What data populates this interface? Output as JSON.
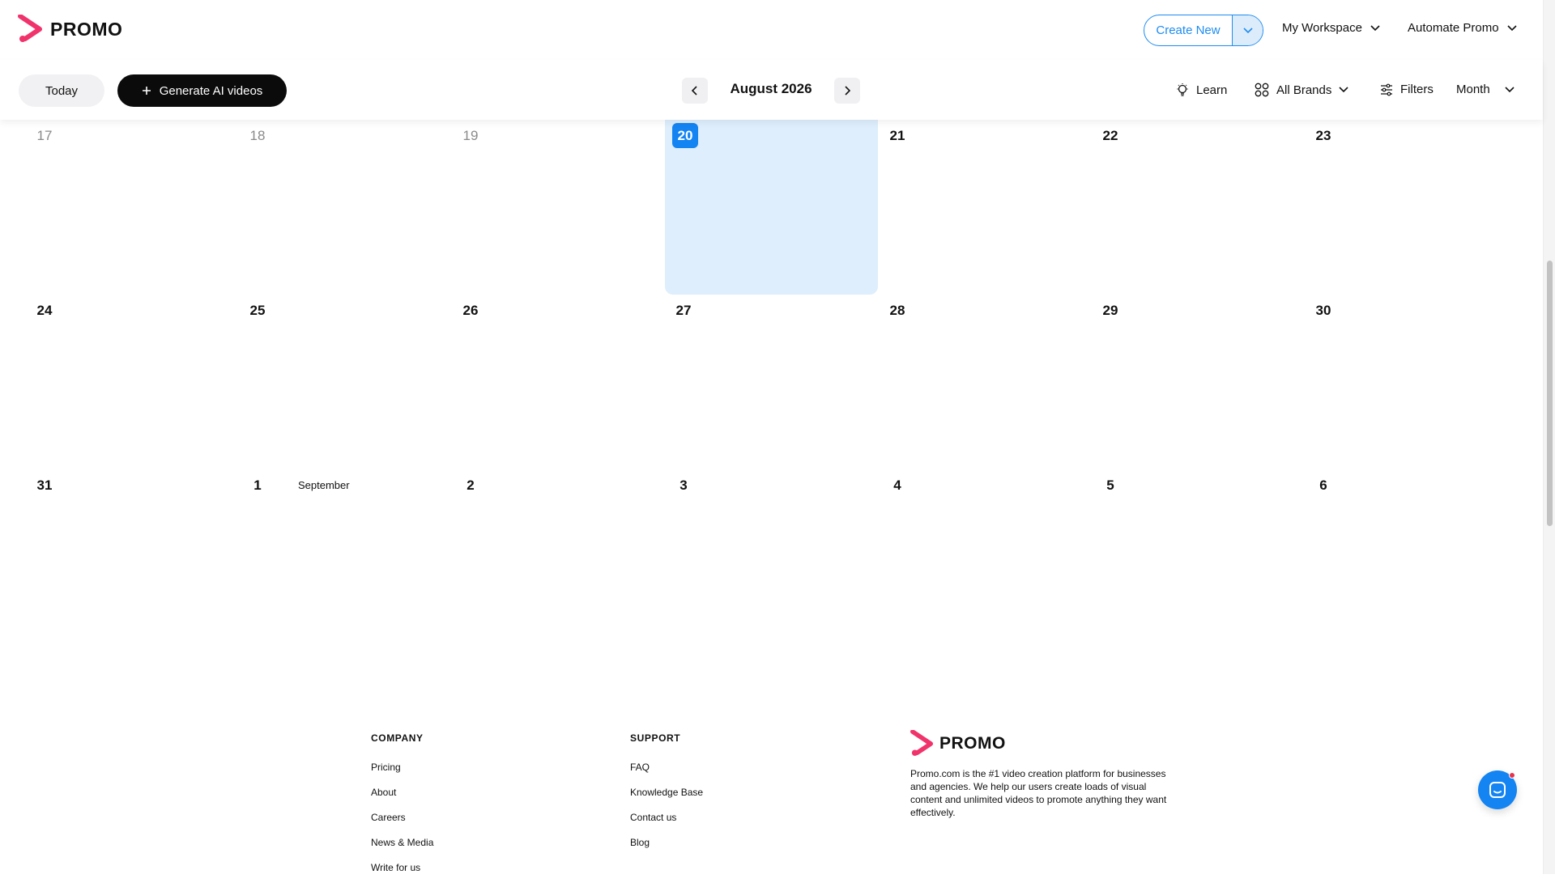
{
  "brand": {
    "name": "PROMO",
    "accent": "#1484f2",
    "logo_color": "#f0336b"
  },
  "header": {
    "create_new": "Create New",
    "workspace": "My Workspace",
    "automate": "Automate Promo"
  },
  "toolbar": {
    "today": "Today",
    "generate": "Generate AI videos",
    "month_title": "August 2026",
    "learn": "Learn",
    "brands": "All Brands",
    "filters": "Filters",
    "view": "Month"
  },
  "calendar": {
    "today": "20",
    "rows": [
      [
        "17",
        "18",
        "19",
        "20",
        "21",
        "22",
        "23"
      ],
      [
        "24",
        "25",
        "26",
        "27",
        "28",
        "29",
        "30"
      ],
      [
        "31",
        "1",
        "2",
        "3",
        "4",
        "5",
        "6"
      ]
    ],
    "month_label": "September"
  },
  "footer": {
    "company": {
      "heading": "COMPANY",
      "links": [
        "Pricing",
        "About",
        "Careers",
        "News & Media",
        "Write for us"
      ]
    },
    "support": {
      "heading": "SUPPORT",
      "links": [
        "FAQ",
        "Knowledge Base",
        "Contact us",
        "Blog"
      ]
    },
    "brand_name": "PROMO",
    "description": "Promo.com is the #1 video creation platform for businesses and agencies. We help our users create loads of visual content and unlimited videos to promote anything they want effectively."
  }
}
